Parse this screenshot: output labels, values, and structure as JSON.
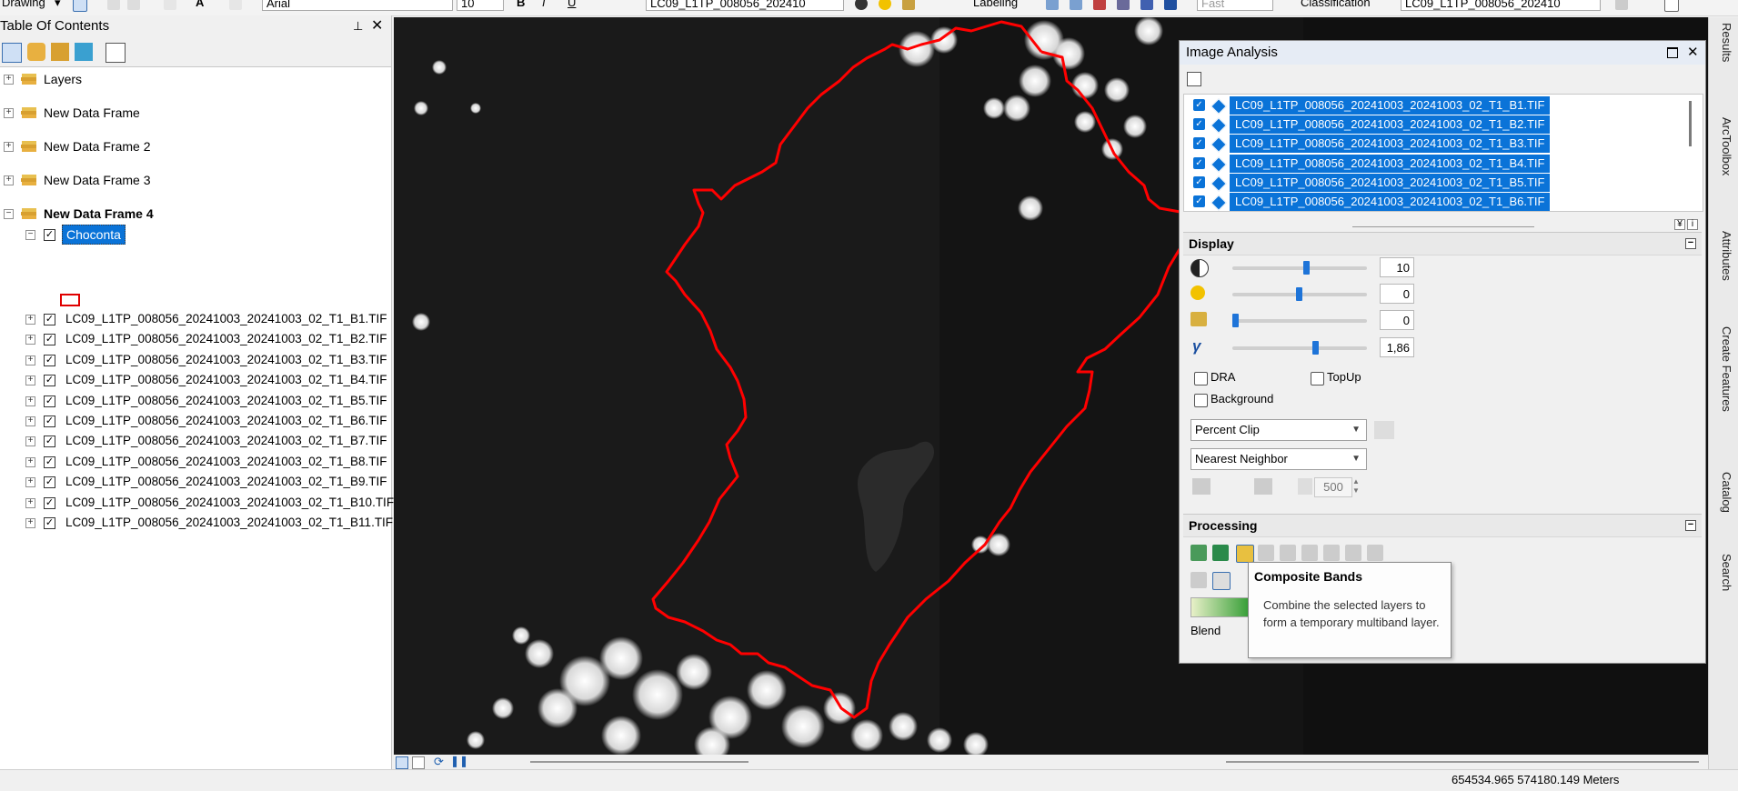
{
  "toolbar": {
    "drawing_label": "Drawing",
    "font_name": "Arial",
    "font_size": "10",
    "bold": "B",
    "italic": "I",
    "underline": "U",
    "layer_combo": "LC09_L1TP_008056_202410",
    "labeling_label": "Labeling",
    "fast_combo": "Fast",
    "classification_label": "Classification",
    "class_layer_combo": "LC09_L1TP_008056_202410"
  },
  "toc": {
    "title": "Table Of Contents",
    "frames": [
      "Layers",
      "New Data Frame",
      "New Data Frame 2",
      "New Data Frame 3"
    ],
    "active_frame": "New Data Frame 4",
    "selected_layer": "Choconta",
    "bands": [
      "LC09_L1TP_008056_20241003_20241003_02_T1_B1.TIF",
      "LC09_L1TP_008056_20241003_20241003_02_T1_B2.TIF",
      "LC09_L1TP_008056_20241003_20241003_02_T1_B3.TIF",
      "LC09_L1TP_008056_20241003_20241003_02_T1_B4.TIF",
      "LC09_L1TP_008056_20241003_20241003_02_T1_B5.TIF",
      "LC09_L1TP_008056_20241003_20241003_02_T1_B6.TIF",
      "LC09_L1TP_008056_20241003_20241003_02_T1_B7.TIF",
      "LC09_L1TP_008056_20241003_20241003_02_T1_B8.TIF",
      "LC09_L1TP_008056_20241003_20241003_02_T1_B9.TIF",
      "LC09_L1TP_008056_20241003_20241003_02_T1_B10.TIF",
      "LC09_L1TP_008056_20241003_20241003_02_T1_B11.TIF"
    ]
  },
  "image_analysis": {
    "title": "Image Analysis",
    "list_bands": [
      "LC09_L1TP_008056_20241003_20241003_02_T1_B1.TIF",
      "LC09_L1TP_008056_20241003_20241003_02_T1_B2.TIF",
      "LC09_L1TP_008056_20241003_20241003_02_T1_B3.TIF",
      "LC09_L1TP_008056_20241003_20241003_02_T1_B4.TIF",
      "LC09_L1TP_008056_20241003_20241003_02_T1_B5.TIF",
      "LC09_L1TP_008056_20241003_20241003_02_T1_B6.TIF"
    ],
    "display": {
      "header": "Display",
      "contrast": "10",
      "brightness": "0",
      "transparency": "0",
      "gamma": "1,86",
      "gamma_symbol": "γ",
      "dra_label": "DRA",
      "topup_label": "TopUp",
      "background_label": "Background",
      "stretch": "Percent Clip",
      "resampling": "Nearest Neighbor",
      "zoom_value": "500"
    },
    "processing": {
      "header": "Processing",
      "blend_label": "Blend"
    }
  },
  "tooltip": {
    "title": "Composite Bands",
    "body": "Combine the selected layers to form a temporary multiband layer."
  },
  "dock_tabs": [
    "Results",
    "ArcToolbox",
    "Attributes",
    "Create Features",
    "Catalog",
    "Search"
  ],
  "status": {
    "coords": "654534.965  574180.149 Meters"
  }
}
